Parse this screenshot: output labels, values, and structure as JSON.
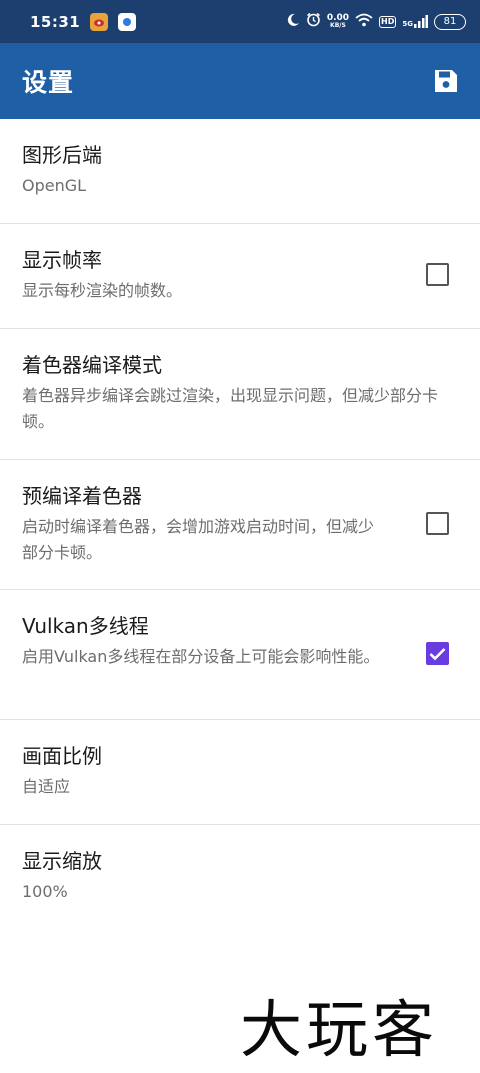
{
  "status_bar": {
    "time": "15:31",
    "net_speed_value": "0.00",
    "net_speed_unit": "KB/S",
    "hd_badge": "HD",
    "network_type": "5G",
    "battery_level": "81"
  },
  "app_bar": {
    "title": "设置",
    "save_icon": "save-icon"
  },
  "settings": [
    {
      "title": "图形后端",
      "subtitle": "OpenGL"
    },
    {
      "title": "显示帧率",
      "subtitle": "显示每秒渲染的帧数。",
      "checked": false
    },
    {
      "title": "着色器编译模式",
      "subtitle": "着色器异步编译会跳过渲染，出现显示问题，但减少部分卡顿。"
    },
    {
      "title": "预编译着色器",
      "subtitle": "启动时编译着色器，会增加游戏启动时间，但减少部分卡顿。",
      "checked": false
    },
    {
      "title": "Vulkan多线程",
      "subtitle": "启用Vulkan多线程在部分设备上可能会影响性能。",
      "checked": true
    },
    {
      "title": "画面比例",
      "subtitle": "自适应"
    },
    {
      "title": "显示缩放",
      "subtitle": "100%"
    }
  ],
  "watermark": "大玩客",
  "colors": {
    "status_bar": "#1c3f70",
    "app_bar": "#1f5fa6",
    "checkbox_checked": "#6a3bdf"
  }
}
